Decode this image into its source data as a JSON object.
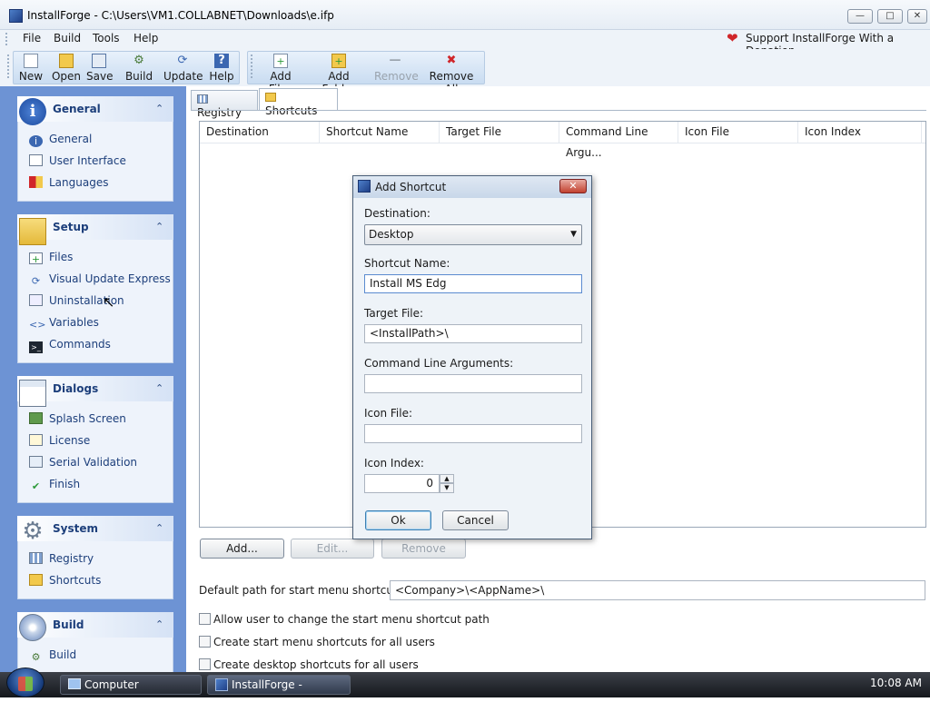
{
  "window": {
    "title": "InstallForge - C:\\Users\\VM1.COLLABNET\\Downloads\\e.ifp"
  },
  "menu": {
    "items": [
      "File",
      "Build",
      "Tools",
      "Help"
    ],
    "donation": "Support InstallForge With a Donation"
  },
  "toolbar": {
    "new": "New",
    "open": "Open",
    "save": "Save",
    "build": "Build",
    "update": "Update",
    "help": "Help",
    "add_files": "Add Files",
    "add_folder": "Add Folder",
    "remove": "Remove",
    "remove_all": "Remove All"
  },
  "sidebar": {
    "general": {
      "title": "General",
      "items": [
        "General",
        "User Interface",
        "Languages"
      ]
    },
    "setup": {
      "title": "Setup",
      "items": [
        "Files",
        "Visual Update Express",
        "Uninstallation",
        "Variables",
        "Commands"
      ]
    },
    "dialogs": {
      "title": "Dialogs",
      "items": [
        "Splash Screen",
        "License",
        "Serial Validation",
        "Finish"
      ]
    },
    "system": {
      "title": "System",
      "items": [
        "Registry",
        "Shortcuts"
      ]
    },
    "build": {
      "title": "Build",
      "items": [
        "Build"
      ]
    }
  },
  "tabs": [
    "Registry",
    "Shortcuts"
  ],
  "table": {
    "columns": [
      "Destination",
      "Shortcut Name",
      "Target File",
      "Command Line Argu...",
      "Icon File",
      "Icon Index"
    ]
  },
  "buttons": {
    "add": "Add...",
    "edit": "Edit...",
    "remove": "Remove"
  },
  "options": {
    "default_path_label": "Default path for start menu shortcuts:",
    "default_path_value": "<Company>\\<AppName>\\",
    "check1": "Allow user to change the start menu shortcut path",
    "check2": "Create start menu shortcuts for all users",
    "check3": "Create desktop shortcuts for all users"
  },
  "dialog": {
    "title": "Add Shortcut",
    "destination_label": "Destination:",
    "destination_value": "Desktop",
    "shortcut_name_label": "Shortcut Name:",
    "shortcut_name_value": "Install MS Edg",
    "target_file_label": "Target File:",
    "target_file_value": "<InstallPath>\\",
    "args_label": "Command Line Arguments:",
    "args_value": "",
    "icon_file_label": "Icon File:",
    "icon_file_value": "",
    "icon_index_label": "Icon Index:",
    "icon_index_value": "0",
    "ok": "Ok",
    "cancel": "Cancel"
  },
  "taskbar": {
    "computer": "Computer",
    "installforge": "InstallForge - C:\\User...",
    "clock": "10:08 AM"
  },
  "colors": {
    "sidebar_bg": "#6d93d4",
    "panel_title": "#1d3f7b",
    "close_red": "#c2412f"
  }
}
